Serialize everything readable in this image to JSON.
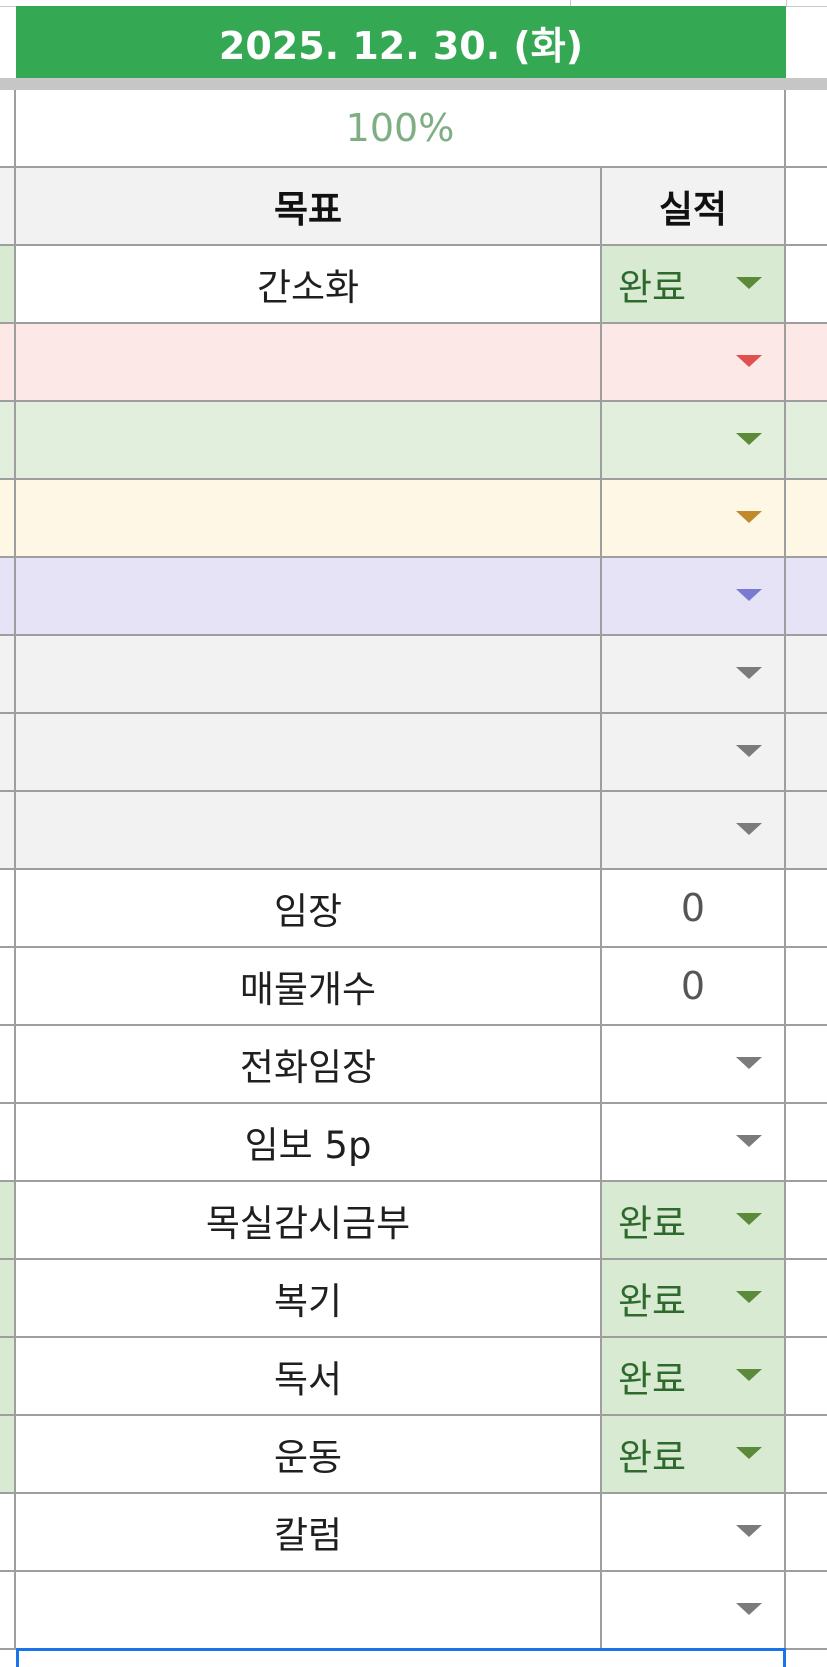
{
  "header": {
    "date": "2025. 12. 30. (화)",
    "progress": "100%",
    "goal_col": "목표",
    "result_col": "실적"
  },
  "colors": {
    "banner": "#34a853",
    "done_bg": "#d9ead3",
    "red_row": "#fde8e8",
    "green_row": "#e3efdd",
    "yellow_row": "#fff7e5",
    "purple_row": "#e6e3f6",
    "gray_row": "#f2f2f2",
    "header_bg": "#f2f2f2"
  },
  "rows": [
    {
      "goal": "간소화",
      "result": "완료",
      "type": "dropdown",
      "bg": "#ffffff",
      "left_bg": "#d9ead3",
      "result_bg": "#d9ead3",
      "arrow": "#5a8a3a"
    },
    {
      "goal": "",
      "result": "",
      "type": "dropdown",
      "bg": "#fde8e8",
      "left_bg": "#fde8e8",
      "result_bg": "#fde8e8",
      "arrow": "#e05050"
    },
    {
      "goal": "",
      "result": "",
      "type": "dropdown",
      "bg": "#e3efdd",
      "left_bg": "#e3efdd",
      "result_bg": "#e3efdd",
      "arrow": "#5a8a3a"
    },
    {
      "goal": "",
      "result": "",
      "type": "dropdown",
      "bg": "#fff7e5",
      "left_bg": "#fff7e5",
      "result_bg": "#fff7e5",
      "arrow": "#c08a2a"
    },
    {
      "goal": "",
      "result": "",
      "type": "dropdown",
      "bg": "#e6e3f6",
      "left_bg": "#e6e3f6",
      "result_bg": "#e6e3f6",
      "arrow": "#7a7ad0"
    },
    {
      "goal": "",
      "result": "",
      "type": "dropdown",
      "bg": "#f2f2f2",
      "left_bg": "#f2f2f2",
      "result_bg": "#f2f2f2",
      "arrow": "#7b7b7b"
    },
    {
      "goal": "",
      "result": "",
      "type": "dropdown",
      "bg": "#f2f2f2",
      "left_bg": "#f2f2f2",
      "result_bg": "#f2f2f2",
      "arrow": "#7b7b7b"
    },
    {
      "goal": "",
      "result": "",
      "type": "dropdown",
      "bg": "#f2f2f2",
      "left_bg": "#f2f2f2",
      "result_bg": "#f2f2f2",
      "arrow": "#7b7b7b"
    },
    {
      "goal": "임장",
      "result": "0",
      "type": "number",
      "bg": "#ffffff",
      "left_bg": "#ffffff",
      "result_bg": "#ffffff",
      "arrow": ""
    },
    {
      "goal": "매물개수",
      "result": "0",
      "type": "number",
      "bg": "#ffffff",
      "left_bg": "#ffffff",
      "result_bg": "#ffffff",
      "arrow": ""
    },
    {
      "goal": "전화임장",
      "result": "",
      "type": "dropdown",
      "bg": "#ffffff",
      "left_bg": "#ffffff",
      "result_bg": "#ffffff",
      "arrow": "#7b7b7b"
    },
    {
      "goal": "임보 5p",
      "result": "",
      "type": "dropdown",
      "bg": "#ffffff",
      "left_bg": "#ffffff",
      "result_bg": "#ffffff",
      "arrow": "#7b7b7b"
    },
    {
      "goal": "목실감시금부",
      "result": "완료",
      "type": "dropdown",
      "bg": "#ffffff",
      "left_bg": "#d9ead3",
      "result_bg": "#d9ead3",
      "arrow": "#5a8a3a"
    },
    {
      "goal": "복기",
      "result": "완료",
      "type": "dropdown",
      "bg": "#ffffff",
      "left_bg": "#d9ead3",
      "result_bg": "#d9ead3",
      "arrow": "#5a8a3a"
    },
    {
      "goal": "독서",
      "result": "완료",
      "type": "dropdown",
      "bg": "#ffffff",
      "left_bg": "#d9ead3",
      "result_bg": "#d9ead3",
      "arrow": "#5a8a3a"
    },
    {
      "goal": "운동",
      "result": "완료",
      "type": "dropdown",
      "bg": "#ffffff",
      "left_bg": "#d9ead3",
      "result_bg": "#d9ead3",
      "arrow": "#5a8a3a"
    },
    {
      "goal": "칼럼",
      "result": "",
      "type": "dropdown",
      "bg": "#ffffff",
      "left_bg": "#ffffff",
      "result_bg": "#ffffff",
      "arrow": "#7b7b7b"
    },
    {
      "goal": "",
      "result": "",
      "type": "dropdown",
      "bg": "#ffffff",
      "left_bg": "#ffffff",
      "result_bg": "#ffffff",
      "arrow": "#7b7b7b"
    }
  ]
}
